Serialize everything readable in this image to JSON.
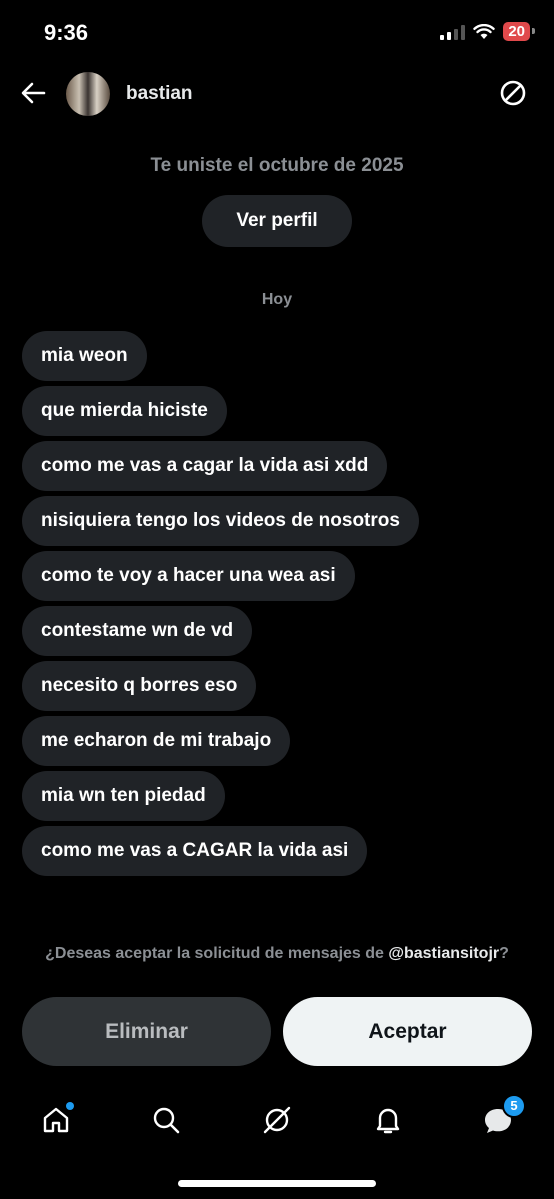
{
  "status_bar": {
    "time": "9:36",
    "battery": "20"
  },
  "header": {
    "username": "bastian"
  },
  "conversation": {
    "joined_text": "Te uniste el octubre de 2025",
    "view_profile_label": "Ver perfil",
    "day_label": "Hoy",
    "messages": [
      "mia weon",
      "que mierda hiciste",
      "como me vas a cagar la vida asi xdd",
      "nisiquiera tengo los videos de nosotros",
      "como te voy a hacer una wea asi",
      "contestame wn de vd",
      "necesito q borres eso",
      "me echaron de mi trabajo",
      "mia wn ten piedad",
      "como me vas a CAGAR la vida asi"
    ]
  },
  "request": {
    "prompt_prefix": "¿Deseas aceptar la solicitud de mensajes de ",
    "handle": "@bastiansitojr",
    "prompt_suffix": "?",
    "delete_label": "Eliminar",
    "accept_label": "Aceptar"
  },
  "tabbar": {
    "items": [
      "home-icon",
      "search-icon",
      "grok-icon",
      "notifications-icon",
      "messages-icon"
    ],
    "messages_badge": "5",
    "accent_color": "#1d9bf0"
  }
}
